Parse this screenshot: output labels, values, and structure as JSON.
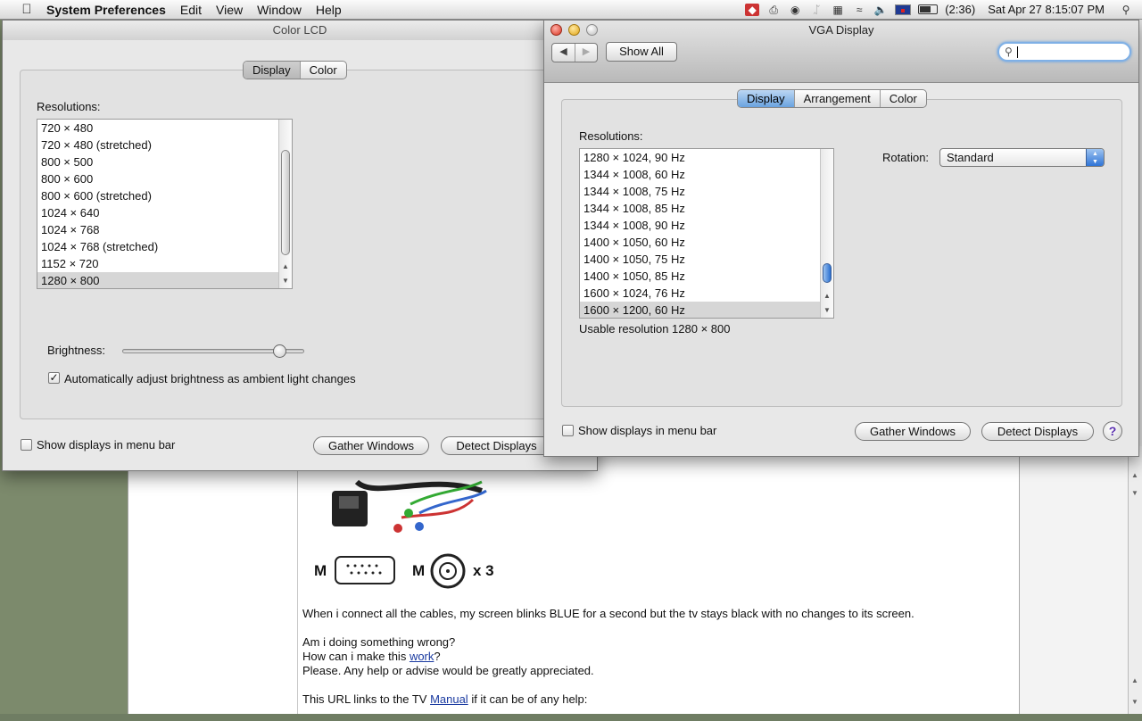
{
  "menubar": {
    "app_name": "System Preferences",
    "items": [
      "Edit",
      "View",
      "Window",
      "Help"
    ],
    "battery": "(2:36)",
    "clock": "Sat Apr 27  8:15:07 PM"
  },
  "color_lcd": {
    "title": "Color LCD",
    "tabs": [
      "Display",
      "Color"
    ],
    "selected_tab": "Display",
    "resolutions_label": "Resolutions:",
    "resolutions": [
      "720 × 480",
      "720 × 480 (stretched)",
      "800 × 500",
      "800 × 600",
      "800 × 600 (stretched)",
      "1024 × 640",
      "1024 × 768",
      "1024 × 768 (stretched)",
      "1152 × 720",
      "1280 × 800"
    ],
    "selected_resolution": "1280 × 800",
    "brightness_label": "Brightness:",
    "brightness_level": 0.86,
    "auto_brightness_label": "Automatically adjust brightness as ambient light changes",
    "auto_brightness_checked": true,
    "show_displays_label": "Show displays in menu bar",
    "gather_windows": "Gather Windows",
    "detect_displays": "Detect Displays"
  },
  "vga_display": {
    "title": "VGA Display",
    "show_all": "Show All",
    "search_value": "",
    "tabs": [
      "Display",
      "Arrangement",
      "Color"
    ],
    "selected_tab": "Display",
    "resolutions_label": "Resolutions:",
    "resolutions": [
      "1280 × 1024, 90 Hz",
      "1344 × 1008, 60 Hz",
      "1344 × 1008, 75 Hz",
      "1344 × 1008, 85 Hz",
      "1344 × 1008, 90 Hz",
      "1400 × 1050, 60 Hz",
      "1400 × 1050, 75 Hz",
      "1400 × 1050, 85 Hz",
      "1600 × 1024, 76 Hz",
      "1600 × 1200, 60 Hz"
    ],
    "selected_resolution": "1600 × 1200, 60 Hz",
    "usable_resolution": "Usable resolution 1280 × 800",
    "rotation_label": "Rotation:",
    "rotation_value": "Standard",
    "show_displays_label": "Show displays in menu bar",
    "gather_windows": "Gather Windows",
    "detect_displays": "Detect Displays",
    "help": "?"
  },
  "background_page": {
    "connector_labels": [
      "M",
      "M",
      "x 3"
    ],
    "paragraphs": [
      "When i connect all the cables, my screen blinks BLUE for a second but the tv stays black with no changes to its screen.",
      "Am i doing something wrong?",
      "How can i make this ",
      "work",
      "?",
      "Please. Any help or advise would be greatly appreciated.",
      "This URL links to the TV ",
      "Manual",
      " if it can be of any help:"
    ]
  }
}
